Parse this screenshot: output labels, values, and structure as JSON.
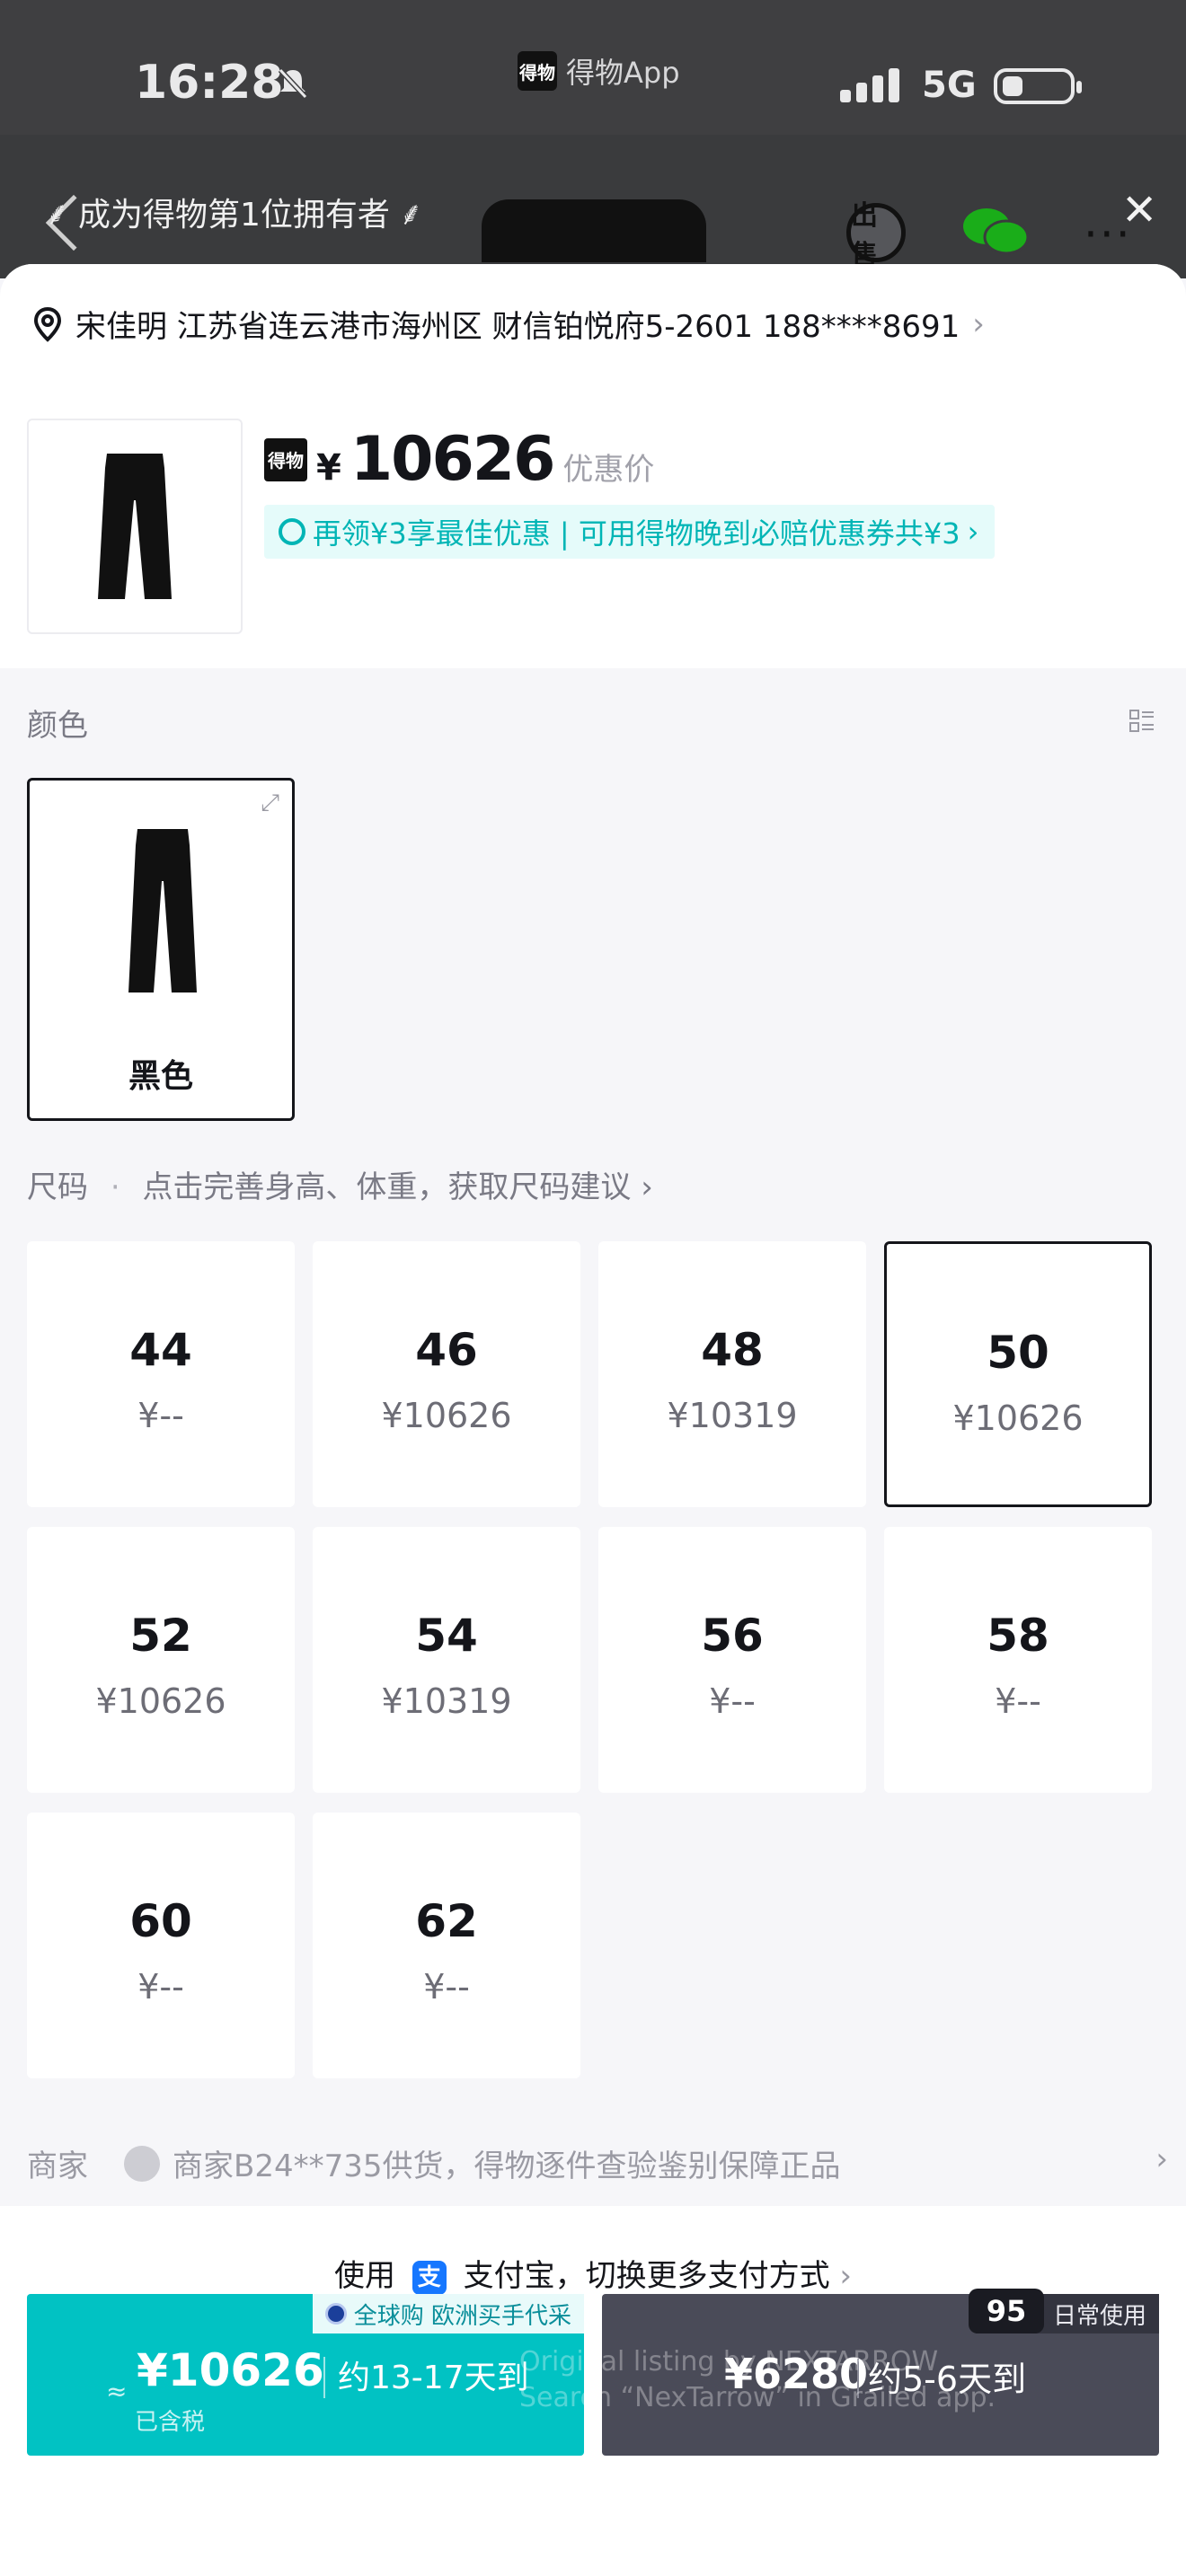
{
  "status_bar": {
    "time": "16:28",
    "app_name": "得物App",
    "app_logo": "得物",
    "network": "5G"
  },
  "header": {
    "owner_banner": "成为得物第1位拥有者",
    "sell_label": "出售"
  },
  "address": {
    "text": "宋佳明 江苏省连云港市海州区 财信铂悦府5-2601 188****8691",
    "chevron": "›"
  },
  "product": {
    "badge": "得物",
    "currency": "¥",
    "price": "10626",
    "price_note": "优惠价",
    "coupon_text": "再领¥3享最佳优惠 | 可用得物晚到必赔优惠券共¥3",
    "coupon_chevron": "›"
  },
  "color_section": {
    "label": "颜色",
    "selected_name": "黑色"
  },
  "size_section": {
    "label": "尺码",
    "hint": "点击完善身高、体重，获取尺码建议",
    "chevron": "›",
    "sizes": [
      {
        "size": "44",
        "price": "¥--"
      },
      {
        "size": "46",
        "price": "¥10626"
      },
      {
        "size": "48",
        "price": "¥10319"
      },
      {
        "size": "50",
        "price": "¥10626",
        "selected": true
      },
      {
        "size": "52",
        "price": "¥10626"
      },
      {
        "size": "54",
        "price": "¥10319"
      },
      {
        "size": "56",
        "price": "¥--"
      },
      {
        "size": "58",
        "price": "¥--"
      },
      {
        "size": "60",
        "price": "¥--"
      },
      {
        "size": "62",
        "price": "¥--"
      }
    ]
  },
  "merchant": {
    "label": "商家",
    "text": "商家B24**735供货，得物逐件查验鉴别保障正品",
    "chevron": "›"
  },
  "payment": {
    "prefix": "使用",
    "alipay_glyph": "支",
    "method": "支付宝，切换更多支付方式",
    "chevron": "›"
  },
  "buy_global": {
    "tag": "全球购 欧洲买手代采",
    "approx": "≈",
    "price": "¥10626",
    "delivery": "约13-17天到",
    "tax": "已含税"
  },
  "buy_daily": {
    "badge": "95",
    "tag": "日常使用",
    "price": "¥6280",
    "delivery": "约5-6天到"
  },
  "watermark": {
    "line1": "Original listing by NEXTARROW",
    "line2": "Search “NexTarrow” in Grailed app.",
    "logo": "NEXTARROW"
  },
  "colors": {
    "accent": "#01c2c3",
    "dark_button": "#4a4b58",
    "coupon_text": "#00b5b5",
    "coupon_bg": "#e5fbfa"
  }
}
